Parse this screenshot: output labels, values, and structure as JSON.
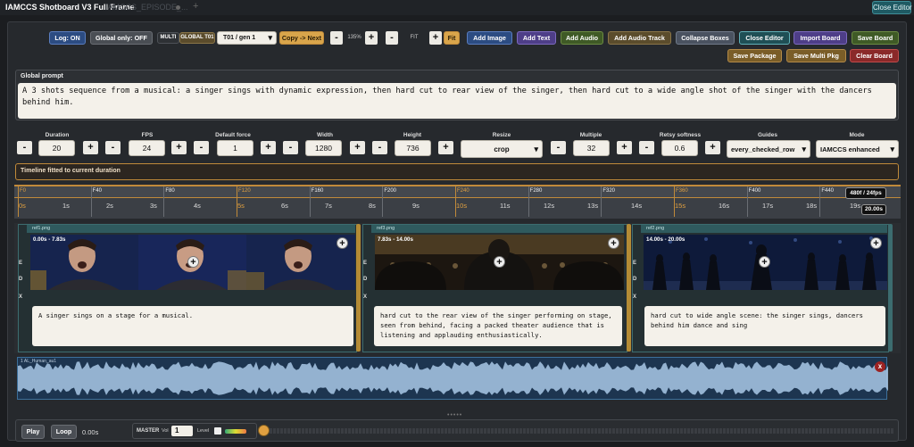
{
  "app": {
    "title": "IAMCCS Shotboard V3 Full Frame",
    "tab_ghost": "IAMCCS_EPISODE_...",
    "close_editor_top": "Close Editor"
  },
  "toolbar": {
    "log": "Log: ON",
    "global_only": "Global only: OFF",
    "multi": "MULTI",
    "global_t01": "GLOBAL T01",
    "take_select": "T01 / gen 1",
    "copy_next": "Copy -> Next",
    "zoom_minus": "-",
    "zoom_value": "135%",
    "zoom_plus": "+",
    "fit_minus": "-",
    "fit_label": "FIT",
    "fit_plus": "+",
    "fit_button": "Fit",
    "add_image": "Add Image",
    "add_text": "Add Text",
    "add_audio": "Add Audio",
    "add_audio_track": "Add Audio Track",
    "collapse_boxes": "Collapse Boxes",
    "close_editor": "Close Editor",
    "import_board": "Import Board",
    "save_board": "Save Board",
    "save_package": "Save Package",
    "save_multi_pkg": "Save Multi Pkg",
    "clear_board": "Clear Board"
  },
  "prompt": {
    "title": "Global prompt",
    "text": "A 3 shots sequence from a musical: a singer sings with dynamic expression, then hard cut to rear view of the singer, then hard cut to a wide angle shot of the singer with the dancers behind him."
  },
  "params": {
    "duration": {
      "label": "Duration",
      "value": "20"
    },
    "fps": {
      "label": "FPS",
      "value": "24"
    },
    "default_force": {
      "label": "Default force",
      "value": "1"
    },
    "width": {
      "label": "Width",
      "value": "1280"
    },
    "height": {
      "label": "Height",
      "value": "736"
    },
    "resize": {
      "label": "Resize",
      "value": "crop"
    },
    "multiple": {
      "label": "Multiple",
      "value": "32"
    },
    "retsy_softness": {
      "label": "Retsy softness",
      "value": "0.6"
    },
    "guides": {
      "label": "Guides",
      "value": "every_checked_row"
    },
    "mode": {
      "label": "Mode",
      "value": "IAMCCS enhanced"
    },
    "minus": "-",
    "plus": "+"
  },
  "timeline": {
    "note": "Timeline fitted to current duration",
    "frame_ticks": [
      "F0",
      "F40",
      "F80",
      "F120",
      "F160",
      "F200",
      "F240",
      "F280",
      "F320",
      "F360",
      "F400",
      "F440"
    ],
    "second_ticks": [
      "0s",
      "1s",
      "2s",
      "3s",
      "4s",
      "5s",
      "6s",
      "7s",
      "8s",
      "9s",
      "10s",
      "11s",
      "12s",
      "13s",
      "14s",
      "15s",
      "16s",
      "17s",
      "18s",
      "19s"
    ],
    "fps_badge": "480f / 24fps",
    "duration_badge": "20.00s"
  },
  "shots": [
    {
      "file": "ref1.png",
      "time": "0.00s - 7.83s",
      "caption": "A singer sings on a stage for a musical."
    },
    {
      "file": "ref3.png",
      "time": "7.83s - 14.00s",
      "caption": "hard cut to the  rear view of the singer performing on stage, seen from behind, facing a packed theater audience that is listening and applauding enthusiastically."
    },
    {
      "file": "ref2.png",
      "time": "14.00s - 20.00s",
      "caption": "hard cut to wide angle scene: the singer sings, dancers behind him dance and sing"
    }
  ],
  "row_letters": {
    "e": "E",
    "d": "D",
    "x": "X"
  },
  "audio": {
    "label": "1 AL_Human_au1",
    "remove": "x"
  },
  "transport": {
    "play": "Play",
    "loop": "Loop",
    "time": "0.00s",
    "master": "MASTER",
    "vol_label": "Vol",
    "vol_value": "1",
    "level_label": "Level"
  },
  "colors": {
    "accent": "#c08a3a",
    "teal": "#3c6c6f",
    "audio": "#1d3550"
  }
}
